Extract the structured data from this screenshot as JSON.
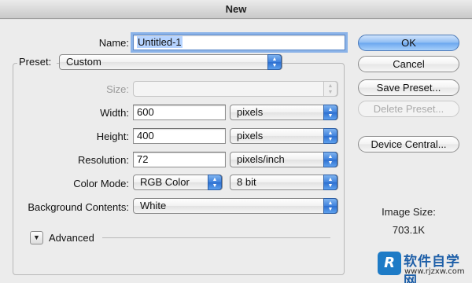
{
  "window": {
    "title": "New"
  },
  "form": {
    "name_label": "Name:",
    "name_value": "Untitled-1",
    "preset_label": "Preset:",
    "preset_value": "Custom",
    "size_label": "Size:",
    "size_value": "",
    "width_label": "Width:",
    "width_value": "600",
    "width_unit": "pixels",
    "height_label": "Height:",
    "height_value": "400",
    "height_unit": "pixels",
    "resolution_label": "Resolution:",
    "resolution_value": "72",
    "resolution_unit": "pixels/inch",
    "color_mode_label": "Color Mode:",
    "color_mode_value": "RGB Color",
    "bit_depth_value": "8 bit",
    "background_label": "Background Contents:",
    "background_value": "White",
    "advanced_label": "Advanced"
  },
  "buttons": {
    "ok": "OK",
    "cancel": "Cancel",
    "save_preset": "Save Preset...",
    "delete_preset": "Delete Preset...",
    "device_central": "Device Central..."
  },
  "image_size": {
    "label": "Image Size:",
    "value": "703.1K"
  },
  "watermark": {
    "logo": "R",
    "text": "软件自学网",
    "url": "www.rjzxw.com"
  },
  "colors": {
    "accent": "#3f82dd",
    "selection": "#b5d3ff",
    "default_button": "#8dbcf3"
  }
}
